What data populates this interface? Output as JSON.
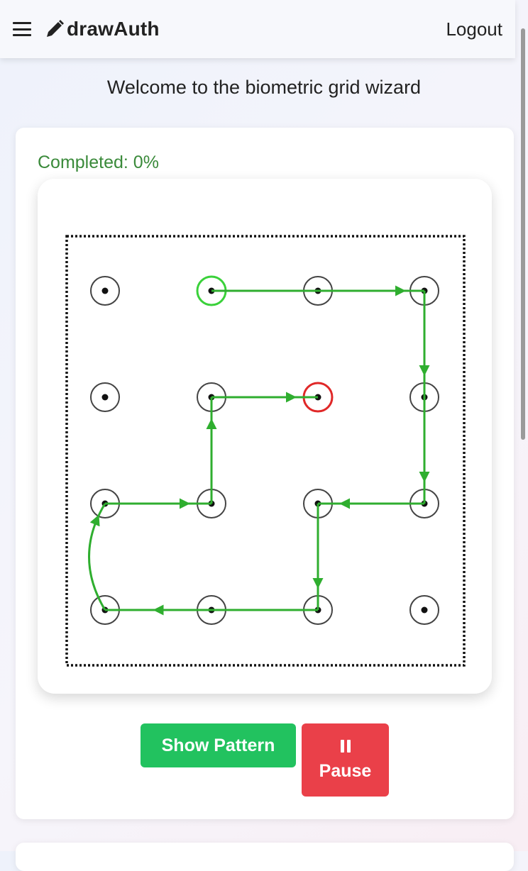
{
  "navbar": {
    "menu_icon": "hamburger-icon",
    "brand_icon": "pencil-icon",
    "brand": "drawAuth",
    "logout": "Logout"
  },
  "welcome": "Welcome to the biometric grid wizard",
  "progress": {
    "text": "Completed: 0%",
    "value": 0
  },
  "grid": {
    "rows": 4,
    "cols": 4,
    "start": [
      1,
      0
    ],
    "end": [
      2,
      1
    ],
    "path": [
      [
        1,
        0
      ],
      [
        3,
        0
      ],
      [
        3,
        1
      ],
      [
        3,
        2
      ],
      [
        2,
        2
      ],
      [
        2,
        3
      ],
      [
        0,
        3
      ],
      [
        0,
        2
      ],
      [
        1,
        2
      ],
      [
        1,
        1
      ],
      [
        2,
        1
      ]
    ],
    "curved_segments": [
      0,
      6
    ],
    "colors": {
      "path": "#2fae2f",
      "start": "#3ad13a",
      "end": "#e02828",
      "dot": "#111111",
      "ring": "#444444"
    }
  },
  "buttons": {
    "show_pattern": "Show Pattern",
    "pause": "Pause",
    "pause_icon": "pause-icon"
  },
  "colors": {
    "progress": "#3a8a3a",
    "show_button": "#22c25f",
    "pause_button": "#ea4049"
  }
}
